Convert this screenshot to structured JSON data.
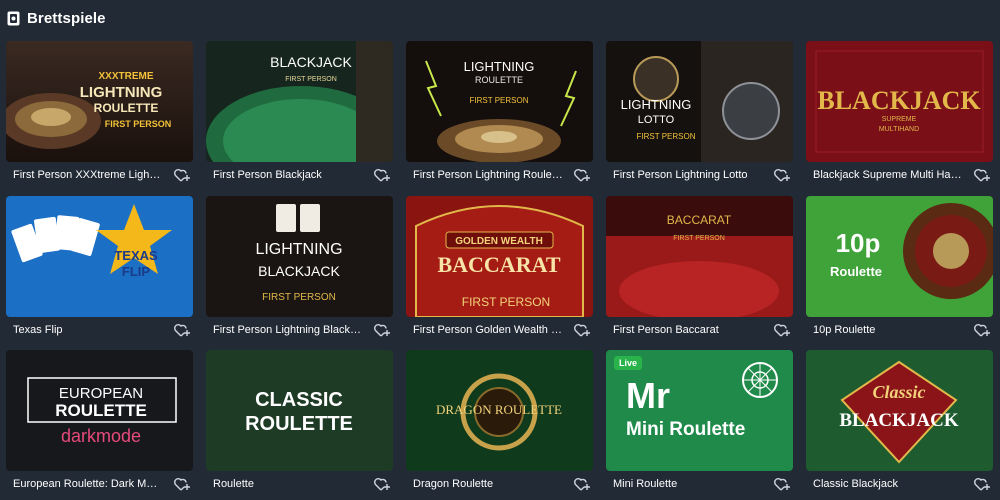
{
  "section": {
    "title": "Brettspiele",
    "icon": "board-games-icon"
  },
  "games": [
    {
      "title": "First Person XXXtreme Lightn…",
      "art_lines": [
        "XXXTREME",
        "LIGHTNING",
        "ROULETTE",
        "FIRST PERSON"
      ]
    },
    {
      "title": "First Person Blackjack",
      "art_lines": [
        "BLACKJACK",
        "FIRST PERSON"
      ]
    },
    {
      "title": "First Person Lightning Roulette",
      "art_lines": [
        "LIGHTNING",
        "ROULETTE",
        "FIRST PERSON"
      ]
    },
    {
      "title": "First Person Lightning Lotto",
      "art_lines": [
        "LIGHTNING",
        "LOTTO",
        "FIRST PERSON"
      ]
    },
    {
      "title": "Blackjack Supreme Multi Han…",
      "art_lines": [
        "BLACKJACK",
        "SUPREME",
        "MULTIHAND"
      ]
    },
    {
      "title": "Texas Flip",
      "art_lines": [
        "TEXAS",
        "FLIP"
      ]
    },
    {
      "title": "First Person Lightning Blackja…",
      "art_lines": [
        "LIGHTNING",
        "BLACKJACK",
        "FIRST PERSON"
      ]
    },
    {
      "title": "First Person Golden Wealth B…",
      "art_lines": [
        "GOLDEN WEALTH",
        "BACCARAT",
        "FIRST PERSON"
      ]
    },
    {
      "title": "First Person Baccarat",
      "art_lines": [
        "BACCARAT",
        "FIRST PERSON"
      ]
    },
    {
      "title": "10p Roulette",
      "art_lines": [
        "10p",
        "Roulette"
      ]
    },
    {
      "title": "European Roulette: Dark Mode",
      "art_lines": [
        "EUROPEAN",
        "ROULETTE",
        "darkmode"
      ]
    },
    {
      "title": "Roulette",
      "art_lines": [
        "CLASSIC",
        "ROULETTE"
      ]
    },
    {
      "title": "Dragon Roulette",
      "art_lines": [
        "DRAGON ROULETTE"
      ]
    },
    {
      "title": "Mini Roulette",
      "art_lines": [
        "Mr",
        "Mini Roulette"
      ],
      "badge": "Live"
    },
    {
      "title": "Classic Blackjack",
      "art_lines": [
        "Classic",
        "BLACKJACK"
      ]
    }
  ],
  "favorite_icon": "heart-plus-icon"
}
